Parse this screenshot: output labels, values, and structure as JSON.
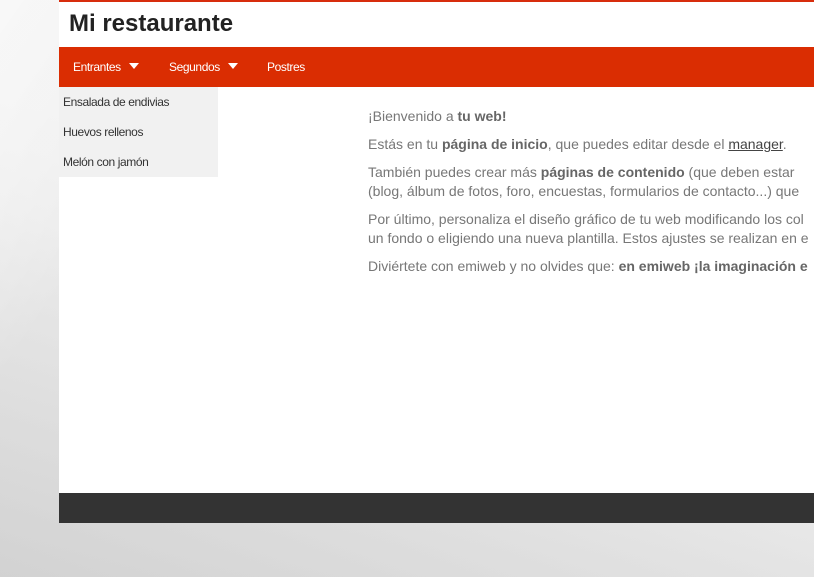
{
  "site": {
    "title": "Mi restaurante"
  },
  "nav": {
    "items": [
      {
        "label": "Entrantes",
        "has_dropdown": true,
        "active": true
      },
      {
        "label": "Segundos",
        "has_dropdown": true
      },
      {
        "label": "Postres",
        "has_dropdown": false
      }
    ],
    "dropdown_items": [
      "Ensalada de endivias",
      "Huevos rellenos",
      "Melón con jamón"
    ]
  },
  "content": {
    "p1": {
      "text": "¡Bienvenido a ",
      "bold": "tu web!"
    },
    "p2": {
      "text": "Estás en tu ",
      "bold": "página de inicio",
      "text2": ", que puedes editar desde el ",
      "link": "manager",
      "text3": "."
    },
    "p3": {
      "line1_text": "También puedes crear más ",
      "line1_bold": "páginas de contenido",
      "line1_rest": " (que deben estar",
      "line2": "(blog, álbum de fotos, foro, encuestas, formularios de contacto...) que"
    },
    "p4": {
      "line1": "Por último, personaliza el diseño gráfico de tu web modificando los col",
      "line2": "un fondo o eligiendo una nueva plantilla. Estos ajustes se realizan en e"
    },
    "p5": {
      "text": "Diviértete con emiweb y no olvides que: ",
      "bold": "en emiweb ¡la imaginación e"
    }
  },
  "colors": {
    "accent": "#da2d02",
    "footer": "#333333",
    "dropdown_bg": "#f1f1f1"
  }
}
